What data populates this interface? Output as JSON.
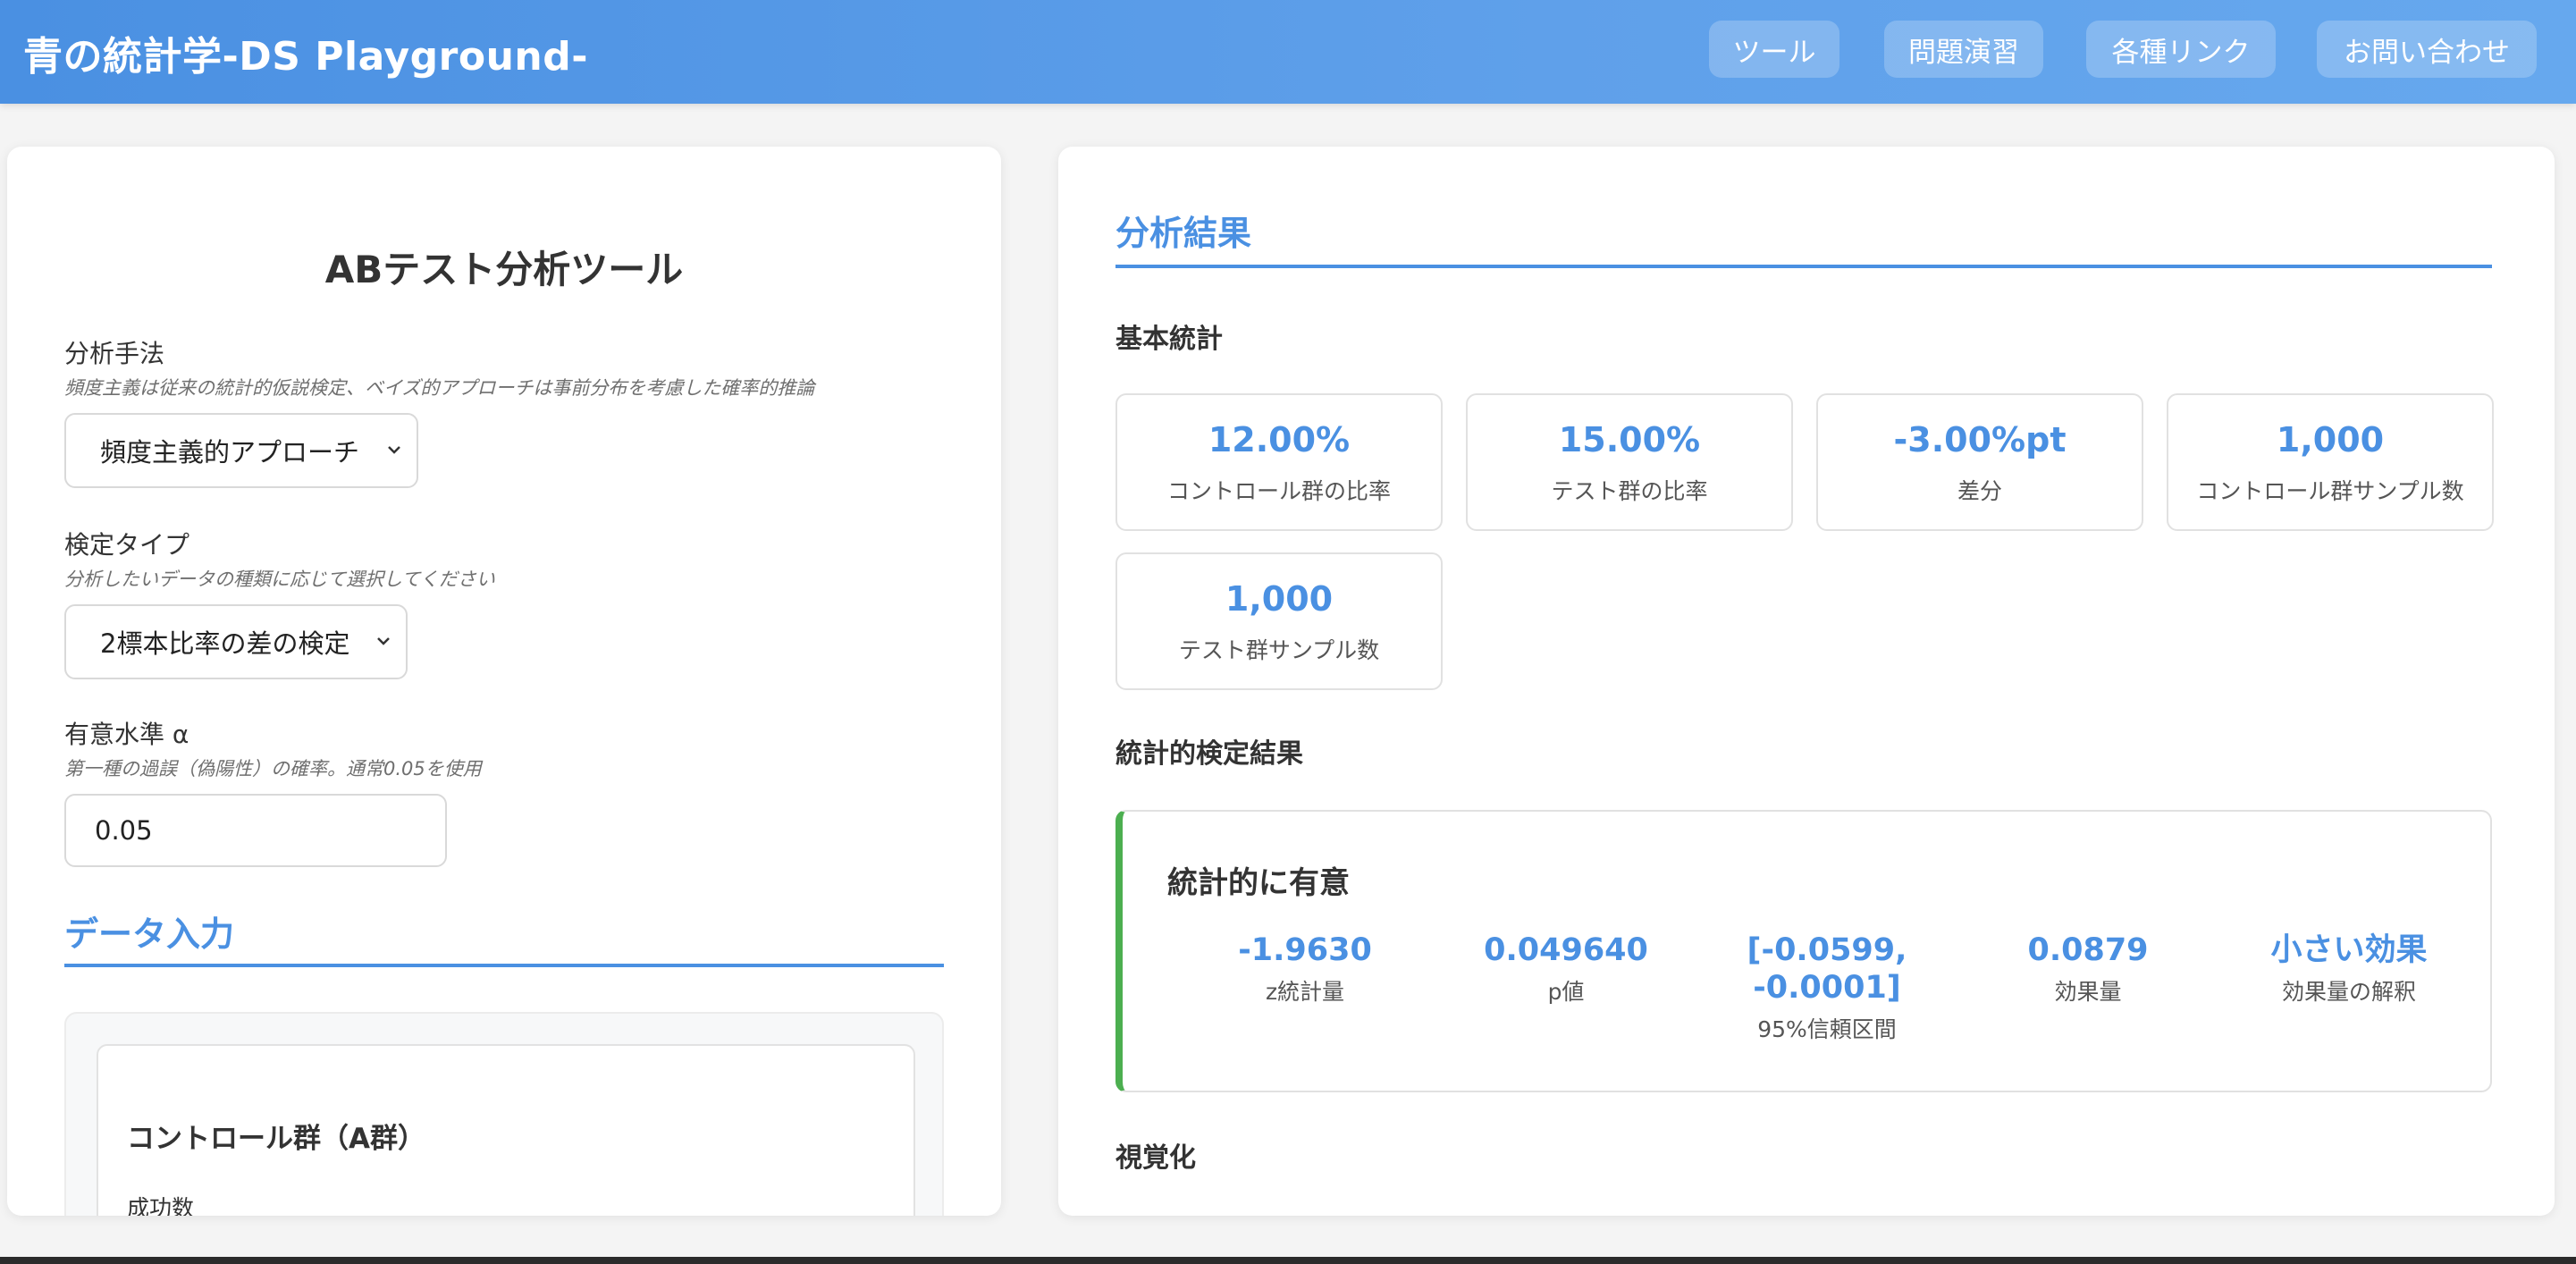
{
  "header": {
    "brand": "青の統計学-DS Playground-",
    "nav": [
      "ツール",
      "問題演習",
      "各種リンク",
      "お問い合わせ"
    ]
  },
  "left": {
    "title": "ABテスト分析ツール",
    "method": {
      "label": "分析手法",
      "hint": "頻度主義は従来の統計的仮説検定、ベイズ的アプローチは事前分布を考慮した確率的推論",
      "value": "頻度主義的アプローチ"
    },
    "test_type": {
      "label": "検定タイプ",
      "hint": "分析したいデータの種類に応じて選択してください",
      "value": "2標本比率の差の検定"
    },
    "alpha": {
      "label": "有意水準 α",
      "hint": "第一種の過誤（偽陽性）の確率。通常0.05を使用",
      "value": "0.05"
    },
    "data_section": {
      "title": "データ入力",
      "control_group_title": "コントロール群（A群）",
      "success_label": "成功数"
    }
  },
  "right": {
    "title": "分析結果",
    "basic_stats_title": "基本統計",
    "stats": [
      {
        "value": "12.00%",
        "label": "コントロール群の比率"
      },
      {
        "value": "15.00%",
        "label": "テスト群の比率"
      },
      {
        "value": "-3.00%pt",
        "label": "差分"
      },
      {
        "value": "1,000",
        "label": "コントロール群サンプル数"
      },
      {
        "value": "1,000",
        "label": "テスト群サンプル数"
      }
    ],
    "test_results_title": "統計的検定結果",
    "result_heading": "統計的に有意",
    "metrics": [
      {
        "value": "-1.9630",
        "label": "z統計量"
      },
      {
        "value": "0.049640",
        "label": "p値"
      },
      {
        "value": "[-0.0599, -0.0001]",
        "value_line1": "[-0.0599,",
        "value_line2": "-0.0001]",
        "label": "95%信頼区間"
      },
      {
        "value": "0.0879",
        "label": "効果量"
      },
      {
        "value": "小さい効果",
        "label": "効果量の解釈"
      }
    ],
    "visualization_title": "視覚化"
  },
  "colors": {
    "accent": "#4a90e2",
    "significant": "#4caf50"
  }
}
